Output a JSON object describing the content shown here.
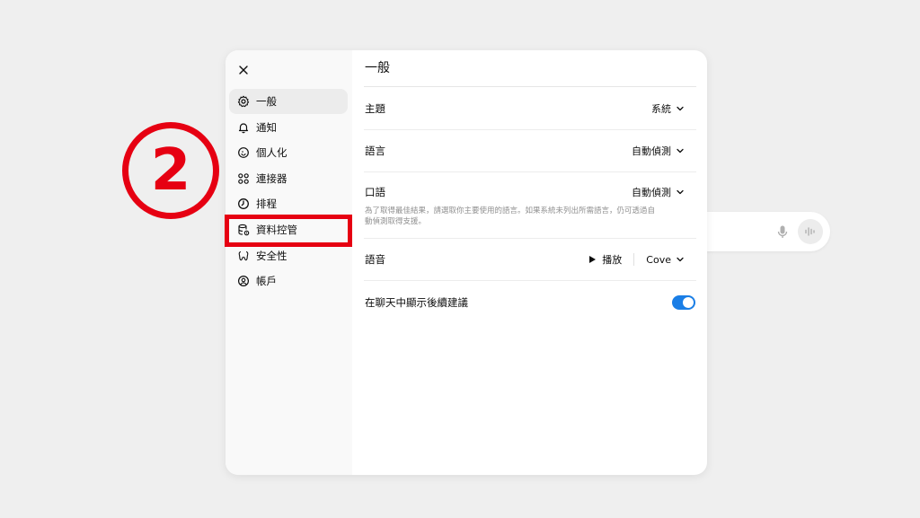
{
  "modal": {
    "title": "一般",
    "sidebar": {
      "items": [
        {
          "label": "一般",
          "icon": "gear-icon",
          "active": true
        },
        {
          "label": "通知",
          "icon": "bell-icon",
          "active": false
        },
        {
          "label": "個人化",
          "icon": "personalization-icon",
          "active": false
        },
        {
          "label": "連接器",
          "icon": "connectors-icon",
          "active": false
        },
        {
          "label": "排程",
          "icon": "clock-icon",
          "active": false
        },
        {
          "label": "資料控管",
          "icon": "database-gear-icon",
          "active": false
        },
        {
          "label": "安全性",
          "icon": "shield-icon",
          "active": false
        },
        {
          "label": "帳戶",
          "icon": "user-circle-icon",
          "active": false
        }
      ]
    },
    "settings": {
      "theme": {
        "label": "主題",
        "value": "系統"
      },
      "language": {
        "label": "語言",
        "value": "自動偵測"
      },
      "spoken_language": {
        "label": "口語",
        "value": "自動偵測",
        "hint": "為了取得最佳結果，請選取你主要使用的語言。如果系統未列出所需語言，仍可透過自動偵測取得支援。"
      },
      "voice": {
        "label": "語音",
        "play_label": "播放",
        "value": "Cove"
      },
      "follow_up": {
        "label": "在聊天中顯示後續建議",
        "enabled": true
      }
    }
  },
  "annotation": {
    "step_number": "2",
    "color": "#e60012"
  },
  "colors": {
    "toggle_on": "#1a7ee6",
    "sidebar_bg": "#f9f9f9",
    "active_item_bg": "#ececec"
  }
}
